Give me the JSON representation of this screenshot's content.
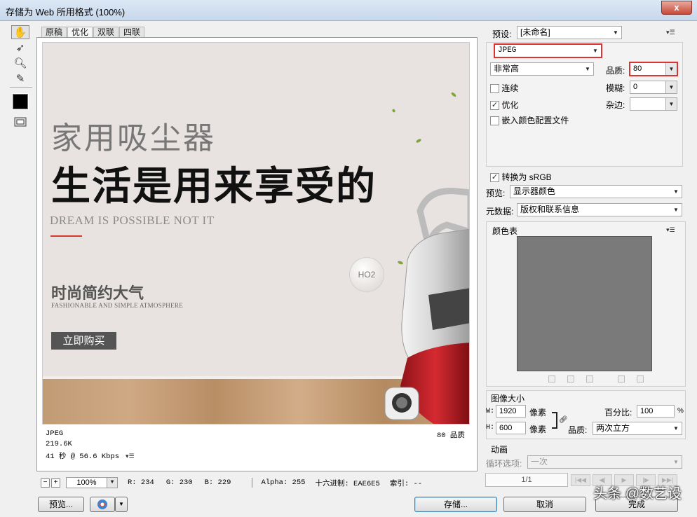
{
  "window": {
    "title": "存储为 Web 所用格式 (100%)",
    "close_label": "x"
  },
  "view_tabs": [
    "原稿",
    "优化",
    "双联",
    "四联"
  ],
  "active_tab": "优化",
  "preview_image": {
    "heading": "家用吸尘器",
    "headline": "生活是用来享受的",
    "english_line": "DREAM IS POSSIBLE NOT IT",
    "subheading": "时尚简约大气",
    "sub_english": "FASHIONABLE AND SIMPLE ATMOSPHERE",
    "button": "立即购买",
    "bubble_text": "HO2"
  },
  "preview_info": {
    "format": "JPEG",
    "size": "219.6K",
    "download_time": "41 秒 @ 56.6 Kbps",
    "quality": "80 品质"
  },
  "status": {
    "zoom": "100%",
    "r": "R: 234",
    "g": "G: 230",
    "b": "B: 229",
    "alpha": "Alpha: 255",
    "hex": "十六进制: EAE6E5",
    "index": "索引: --"
  },
  "buttons": {
    "preview": "预览...",
    "save": "存储...",
    "cancel": "取消",
    "done": "完成"
  },
  "settings": {
    "preset_label": "预设:",
    "preset_value": "[未命名]",
    "format": "JPEG",
    "quality_level": "非常高",
    "quality_label": "品质:",
    "quality_value": "80",
    "progressive_label": "连续",
    "progressive": false,
    "blur_label": "模糊:",
    "blur_value": "0",
    "optimized_label": "优化",
    "optimized": true,
    "matte_label": "杂边:",
    "matte_value": "",
    "embed_profile_label": "嵌入颜色配置文件",
    "embed_profile": false,
    "convert_srgb_label": "转换为 sRGB",
    "convert_srgb": true,
    "preview_label": "预览:",
    "preview_value": "显示器颜色",
    "metadata_label": "元数据:",
    "metadata_value": "版权和联系信息"
  },
  "color_table": {
    "title": "颜色表",
    "swatch_color": "#7a7a7a"
  },
  "image_size": {
    "title": "图像大小",
    "w_label": "W:",
    "w_value": "1920",
    "h_label": "H:",
    "h_value": "600",
    "unit": "像素",
    "percent_label": "百分比:",
    "percent_value": "100",
    "percent_unit": "%",
    "quality_label": "品质:",
    "quality_value": "两次立方"
  },
  "animation": {
    "title": "动画",
    "loop_label": "循环选项:",
    "loop_value": "一次",
    "frame_counter": "1/1"
  },
  "watermark": "头条 @数艺设",
  "colors": {
    "accent_red": "#d33333",
    "foreground_swatch": "#000000"
  }
}
